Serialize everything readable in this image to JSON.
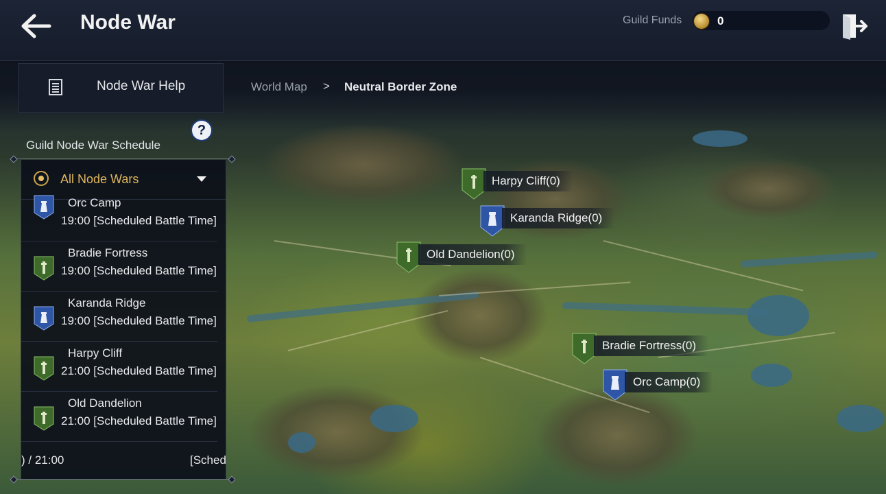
{
  "header": {
    "title": "Node War",
    "guild_funds_label": "Guild Funds",
    "guild_funds_value": "0"
  },
  "sidebar": {
    "help_label": "Node War Help",
    "schedule_title": "Guild Node War Schedule",
    "help_badge": "?",
    "filter_label": "All Node Wars",
    "entries": [
      {
        "name": "Orc Camp",
        "time": "[Scheduled Battle Time] 19:00",
        "color": "blue"
      },
      {
        "name": "Bradie Fortress",
        "time": "[Scheduled Battle Time] 19:00",
        "color": "green"
      },
      {
        "name": "Karanda Ridge",
        "time": "[Scheduled Battle Time] 19:00",
        "color": "blue"
      },
      {
        "name": "Harpy Cliff",
        "time": "[Scheduled Battle Time] 21:00",
        "color": "green"
      },
      {
        "name": "Old Dandelion",
        "time": "[Scheduled Battle Time] 21:00",
        "color": "green"
      }
    ],
    "footer_left": ") / 21:00",
    "footer_right": "[Sched"
  },
  "breadcrumb": {
    "root": "World Map",
    "separator": ">",
    "current": "Neutral Border Zone"
  },
  "map": {
    "markers": [
      {
        "label": "Harpy Cliff(0)",
        "color": "green"
      },
      {
        "label": "Karanda Ridge(0)",
        "color": "blue"
      },
      {
        "label": "Old Dandelion(0)",
        "color": "green"
      },
      {
        "label": "Bradie Fortress(0)",
        "color": "green"
      },
      {
        "label": "Orc Camp(0)",
        "color": "blue"
      }
    ]
  },
  "colors": {
    "accent_gold": "#e0b65e",
    "node_green": "#3f6b2a",
    "node_blue": "#2f56a6"
  }
}
